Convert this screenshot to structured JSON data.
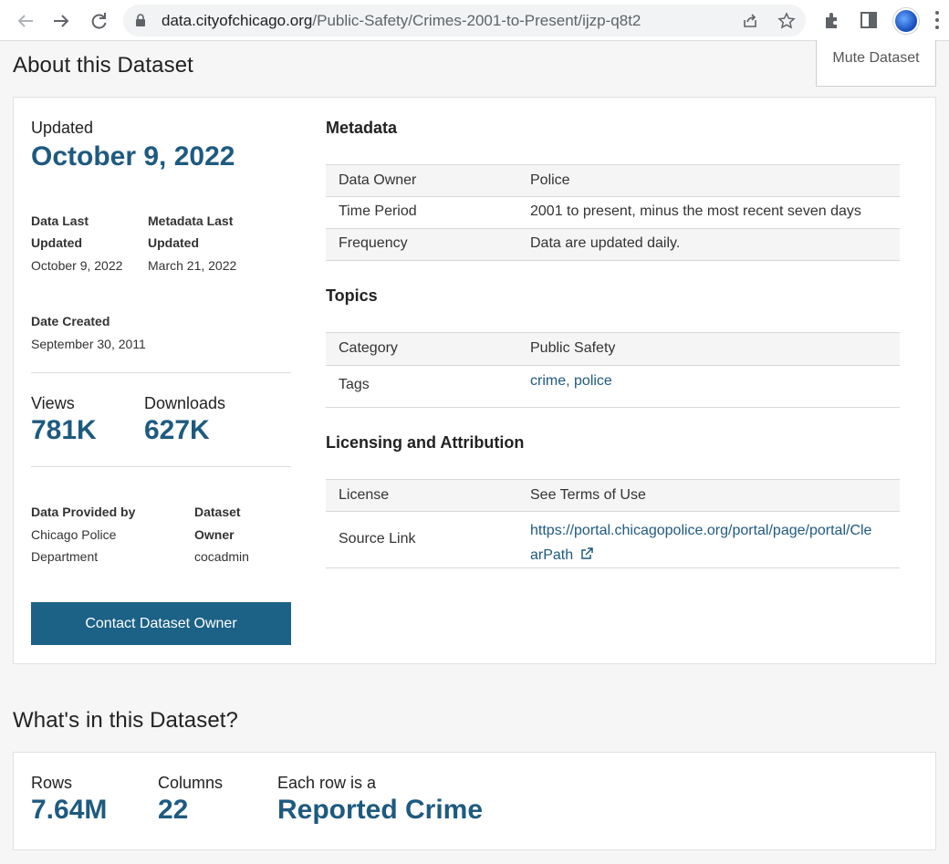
{
  "browser": {
    "url_host": "data.cityofchicago.org",
    "url_path": "/Public-Safety/Crimes-2001-to-Present/ijzp-q8t2"
  },
  "about": {
    "heading": "About this Dataset",
    "mute_label": "Mute Dataset",
    "updated_label": "Updated",
    "updated_date": "October 9, 2022",
    "data_last_updated_label_1": "Data Last",
    "data_last_updated_label_2": "Updated",
    "data_last_updated_value": "October 9, 2022",
    "metadata_last_updated_label_1": "Metadata Last",
    "metadata_last_updated_label_2": "Updated",
    "metadata_last_updated_value": "March 21, 2022",
    "date_created_label": "Date Created",
    "date_created_value": "September 30, 2011",
    "views_label": "Views",
    "views_value": "781K",
    "downloads_label": "Downloads",
    "downloads_value": "627K",
    "provided_by_label": "Data Provided by",
    "provided_by_value_1": "Chicago Police",
    "provided_by_value_2": "Department",
    "owner_label_1": "Dataset",
    "owner_label_2": "Owner",
    "owner_value": "cocadmin",
    "contact_button": "Contact Dataset Owner"
  },
  "metadata": {
    "title": "Metadata",
    "rows": [
      {
        "key": "Data Owner",
        "value": "Police"
      },
      {
        "key": "Time Period",
        "value": "2001 to present, minus the most recent seven days"
      },
      {
        "key": "Frequency",
        "value": "Data are updated daily."
      }
    ]
  },
  "topics": {
    "title": "Topics",
    "category_key": "Category",
    "category_value": "Public Safety",
    "tags_key": "Tags",
    "tags": [
      "crime",
      "police"
    ]
  },
  "licensing": {
    "title": "Licensing and Attribution",
    "license_key": "License",
    "license_value": "See Terms of Use",
    "source_key": "Source Link",
    "source_value_1": "https://portal.chicagopolice.org/portal/page/portal/Cle",
    "source_value_2": "arPath"
  },
  "whats_in": {
    "heading": "What's in this Dataset?",
    "rows_label": "Rows",
    "rows_value": "7.64M",
    "columns_label": "Columns",
    "columns_value": "22",
    "each_row_label": "Each row is a",
    "each_row_value": "Reported Crime"
  },
  "colors": {
    "accent": "#1e5a80",
    "button": "#1c6186"
  }
}
